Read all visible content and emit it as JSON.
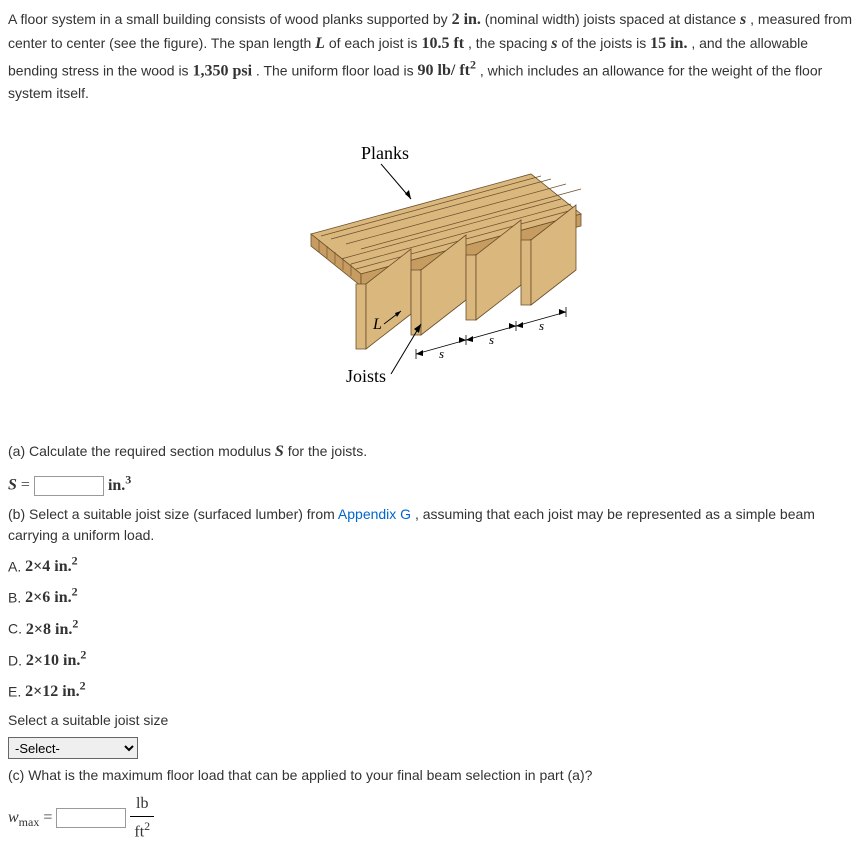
{
  "problem": {
    "intro_p1": "A floor system in a small building consists of wood planks supported by ",
    "val1": "2 in.",
    "intro_p2": " (nominal width) joists spaced at distance ",
    "val_s": "s",
    "intro_p3": ", measured from center to center (see the figure). The span length ",
    "val_L": "L",
    "intro_p4": " of each joist is ",
    "val2": "10.5 ft",
    "intro_p5": ", the spacing ",
    "intro_p6": " of the joists is ",
    "val3": "15 in.",
    "intro_p7": ", and the allowable bending stress in the wood is ",
    "val4": "1,350 psi",
    "intro_p8": ". The uniform floor load is ",
    "val5": "90 lb/ ft",
    "val5_sup": "2",
    "intro_p9": ", which includes an allowance for the weight of the floor system itself."
  },
  "figure": {
    "label_planks": "Planks",
    "label_joists": "Joists",
    "label_L": "L",
    "label_s": "s"
  },
  "partA": {
    "text": "(a) Calculate the required section modulus ",
    "S": "S",
    "text2": " for the joists.",
    "eq_left": "S",
    "eq_op": " = ",
    "unit": "in.",
    "unit_sup": "3"
  },
  "partB": {
    "text1": "(b) Select a suitable joist size (surfaced lumber) from ",
    "link": "Appendix G",
    "text2": ", assuming that each joist may be represented as a simple beam carrying a uniform load.",
    "options": {
      "A_label": "A. ",
      "A_val": "2×4  in.",
      "B_label": "B. ",
      "B_val": "2×6  in.",
      "C_label": "C. ",
      "C_val": "2×8  in.",
      "D_label": "D. ",
      "D_val": "2×10  in.",
      "E_label": "E. ",
      "E_val": "2×12  in.",
      "sup": "2"
    },
    "select_label": "Select a suitable joist size",
    "select_placeholder": "-Select-"
  },
  "partC": {
    "text": "(c) What is the maximum floor load that can be applied to your final beam selection in part (a)?",
    "var": "w",
    "var_sub": "max",
    "eq_op": " = ",
    "unit_num": "lb",
    "unit_den_base": "ft",
    "unit_den_sup": "2"
  }
}
